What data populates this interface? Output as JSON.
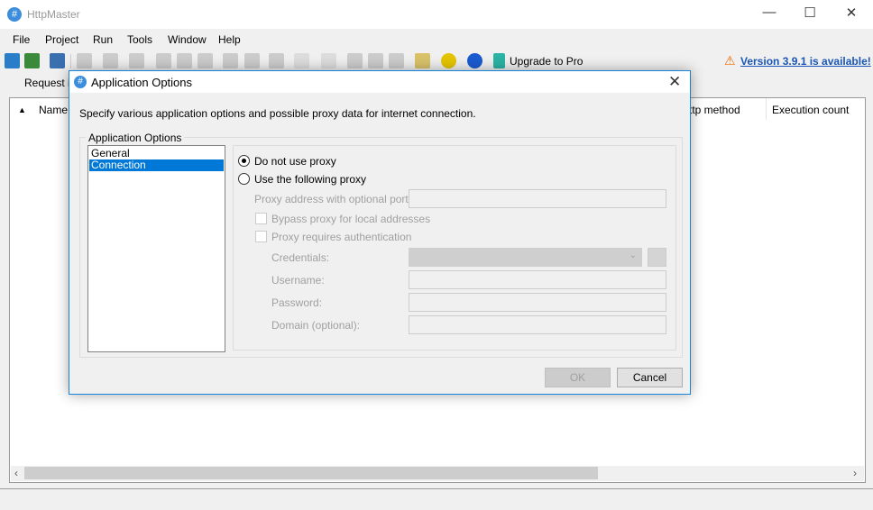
{
  "app": {
    "title": "HttpMaster"
  },
  "window_controls": {
    "minimize": "—",
    "maximize": "☐",
    "close": "✕"
  },
  "menu": [
    "File",
    "Project",
    "Run",
    "Tools",
    "Window",
    "Help"
  ],
  "toolbar": {
    "upgrade_label": "Upgrade to Pro",
    "version_link": "Version 3.9.1 is available!"
  },
  "tabs": [
    "Request it"
  ],
  "table": {
    "columns": [
      "Name",
      "ttp method",
      "Execution count"
    ]
  },
  "dialog": {
    "title": "Application Options",
    "description": "Specify various application options and possible proxy data for internet connection.",
    "group_label": "Application Options",
    "nav": [
      {
        "label": "General",
        "selected": false
      },
      {
        "label": "Connection",
        "selected": true
      }
    ],
    "radio_no_proxy": "Do not use proxy",
    "radio_use_proxy": "Use the following proxy",
    "proxy_address_label": "Proxy address with optional port:",
    "bypass_label": "Bypass proxy for local addresses",
    "auth_label": "Proxy requires authentication",
    "credentials_label": "Credentials:",
    "username_label": "Username:",
    "password_label": "Password:",
    "domain_label": "Domain (optional):",
    "ok": "OK",
    "cancel": "Cancel"
  }
}
